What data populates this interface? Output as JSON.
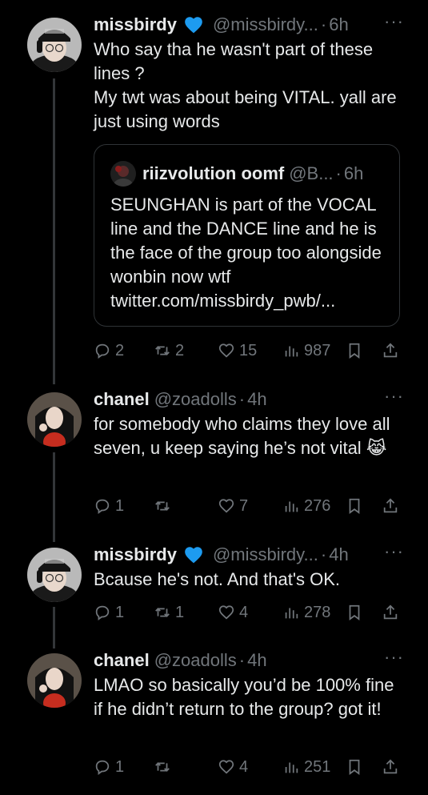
{
  "tweets": [
    {
      "name": "missbirdy",
      "handle": "@missbirdy...",
      "time": "6h",
      "text": "Who say tha he wasn't part of these lines ?\nMy twt was about being VITAL. yall are just using words",
      "quote": {
        "name": "riizvolution oomf",
        "handle": "@B...",
        "time": "6h",
        "text": "SEUNGHAN is part of the VOCAL line and the DANCE line and he is the face of the group too alongside wonbin now wtf twitter.com/missbirdy_pwb/..."
      },
      "replies": "2",
      "retweets": "2",
      "likes": "15",
      "views": "987"
    },
    {
      "name": "chanel",
      "handle": "@zoadolls",
      "time": "4h",
      "text": "for somebody who claims they love all seven, u keep saying he’s not vital 😹",
      "replies": "1",
      "retweets": "",
      "likes": "7",
      "views": "276"
    },
    {
      "name": "missbirdy",
      "handle": "@missbirdy...",
      "time": "4h",
      "text": "Bcause he's not. And that's OK.",
      "replies": "1",
      "retweets": "1",
      "likes": "4",
      "views": "278"
    },
    {
      "name": "chanel",
      "handle": "@zoadolls",
      "time": "4h",
      "text": "LMAO so basically you’d be 100% fine if he didn’t return to the group? got it!",
      "replies": "1",
      "retweets": "",
      "likes": "4",
      "views": "251"
    }
  ],
  "dot": "·",
  "more": "···",
  "icons": {
    "verified": "verified-badge-icon",
    "reply": "reply-icon",
    "retweet": "retweet-icon",
    "like": "heart-icon",
    "views": "views-icon",
    "bookmark": "bookmark-icon",
    "share": "share-icon"
  },
  "colors": {
    "background": "#000000",
    "text": "#e7e9ea",
    "secondary": "#71767b",
    "verified": "#1d9bf0",
    "thread_line": "#333639"
  }
}
